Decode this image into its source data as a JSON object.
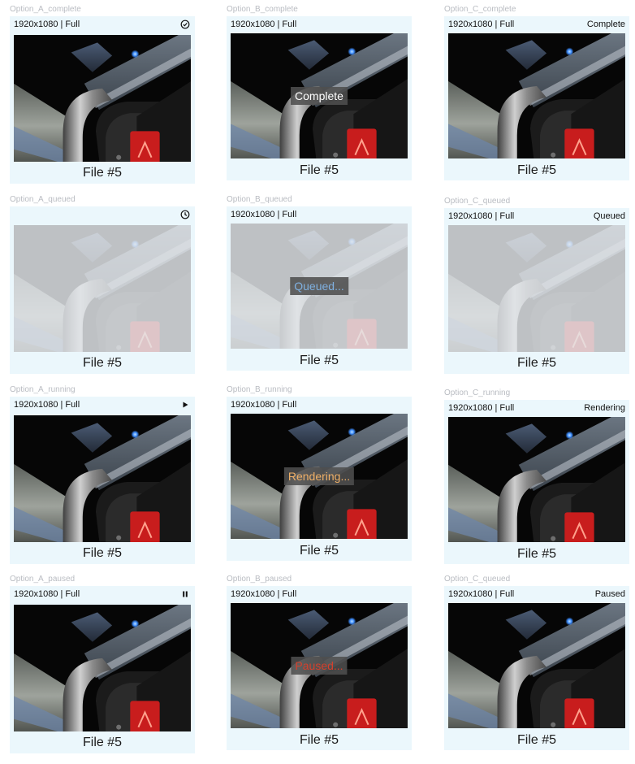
{
  "colors": {
    "card_bg": "#ebf7fc",
    "option_label": "#b9bcc2",
    "overlay_complete": "#ffffff",
    "overlay_queued": "#7fb0e0",
    "overlay_running": "#f0b067",
    "overlay_paused": "#d5402c"
  },
  "rows": [
    {
      "a": {
        "option": "Option_A_complete",
        "resolution": "1920x1080 | Full",
        "icon": "check-circle-icon",
        "file": "File #5"
      },
      "b": {
        "option": "Option_B_complete",
        "resolution": "1920x1080 | Full",
        "overlay": "Complete",
        "file": "File #5"
      },
      "c": {
        "option": "Option_C_complete",
        "resolution": "1920x1080 | Full",
        "status": "Complete",
        "file": "File #5"
      }
    },
    {
      "a": {
        "option": "Option_A_queued",
        "resolution": "",
        "icon": "clock-icon",
        "file": "File #5"
      },
      "b": {
        "option": "Option_B_queued",
        "resolution": "1920x1080 | Full",
        "overlay": "Queued...",
        "file": "File #5"
      },
      "c": {
        "option": "Option_C_queued",
        "resolution": "1920x1080 | Full",
        "status": "Queued",
        "file": "File #5"
      }
    },
    {
      "a": {
        "option": "Option_A_running",
        "resolution": "1920x1080 | Full",
        "icon": "play-icon",
        "file": "File #5"
      },
      "b": {
        "option": "Option_B_running",
        "resolution": "1920x1080 | Full",
        "overlay": "Rendering...",
        "file": "File #5"
      },
      "c": {
        "option": "Option_C_running",
        "resolution": "1920x1080 | Full",
        "status": "Rendering",
        "file": "File #5"
      }
    },
    {
      "a": {
        "option": "Option_A_paused",
        "resolution": "1920x1080 | Full",
        "icon": "pause-icon",
        "file": "File #5"
      },
      "b": {
        "option": "Option_B_paused",
        "resolution": "1920x1080 | Full",
        "overlay": "Paused...",
        "file": "File #5"
      },
      "c": {
        "option": "Option_C_queued",
        "resolution": "1920x1080 | Full",
        "status": "Paused",
        "file": "File #5"
      }
    }
  ]
}
